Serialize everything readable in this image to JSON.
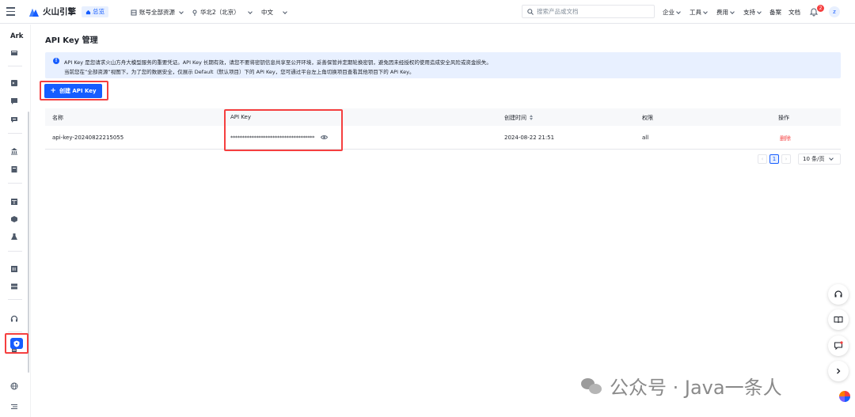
{
  "header": {
    "logo_text": "火山引擎",
    "home_label": "总览",
    "account_dropdown": "账号全部资源",
    "region_dropdown": "华北2（北京）",
    "language_dropdown": "中文",
    "search_placeholder": "搜索产品或文档",
    "links": [
      "企业",
      "工具",
      "费用",
      "支持",
      "备案",
      "文档"
    ],
    "notification_count": "2",
    "avatar_initial": "z"
  },
  "sidebar": {
    "title": "Ark",
    "icons": [
      "console-icon",
      "terminal-icon",
      "chat-icon",
      "message-icon",
      "bank-icon",
      "book-icon",
      "table-icon",
      "cube-icon",
      "flask-icon",
      "stack-icon",
      "server-icon",
      "headset-icon",
      "doc-icon",
      "shield-key-icon",
      "globe-icon",
      "settings-list-icon"
    ],
    "active_item": "shield-key-icon"
  },
  "page": {
    "title": "API Key 管理",
    "alert_line1": "API Key 是您请求火山方舟大模型服务的重要凭证。API Key 长期有效，请您不要将密钥信息共享至公开环境，妥善保管并定期轮换密钥，避免因未经授权的使用造成安全风险或资金损失。",
    "alert_line2": "当前您在“全部资源”视图下，为了您的数据安全，仅展示 Default（默认项目）下的 API Key，您可通过平台左上角切换项目查看其他项目下的 API Key。",
    "create_button": "创建 API Key"
  },
  "table": {
    "columns": [
      "名称",
      "API Key",
      "创建时间",
      "权限",
      "操作"
    ],
    "rows": [
      {
        "name": "api-key-20240822215055",
        "api_key": "************************************",
        "created": "2024-08-22 21:51",
        "permission": "all",
        "action": "删除"
      }
    ]
  },
  "pagination": {
    "current_page": "1",
    "page_size": "10 条/页"
  },
  "watermark": {
    "text": "公众号 · Java一条人"
  },
  "colors": {
    "primary": "#165dff",
    "danger": "#f53f3f",
    "alert_bg": "#e8f0ff"
  }
}
